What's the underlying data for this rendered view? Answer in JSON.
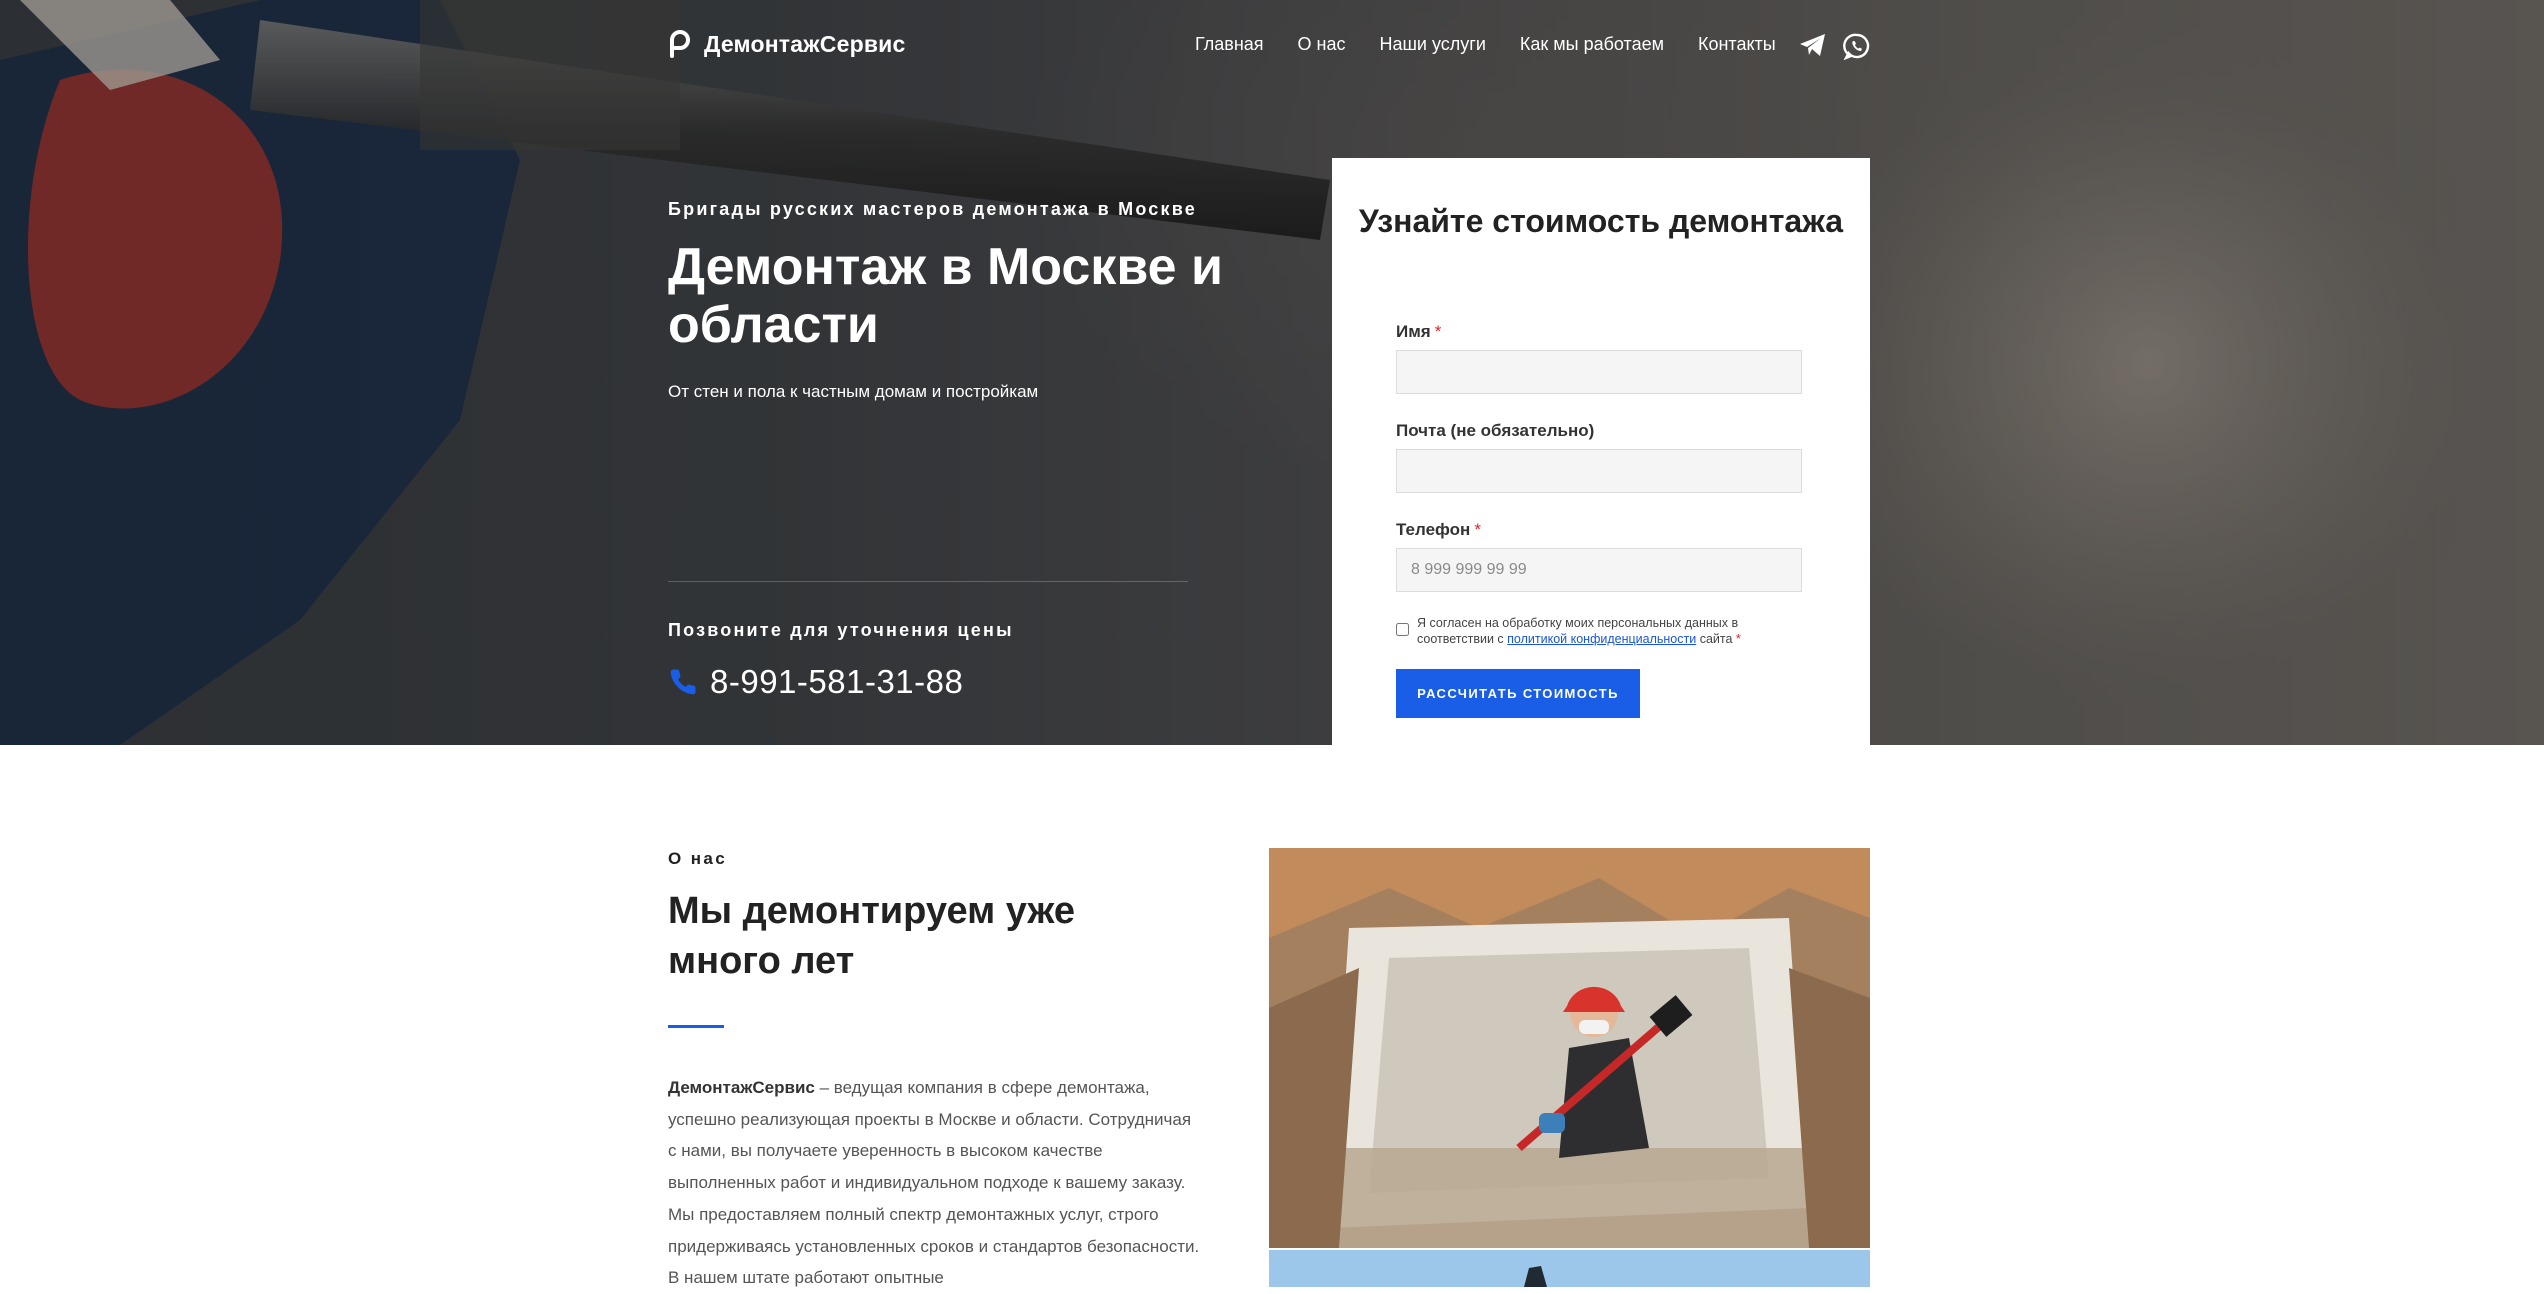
{
  "header": {
    "brand": "ДемонтажСервис",
    "nav": [
      {
        "label": "Главная"
      },
      {
        "label": "О нас"
      },
      {
        "label": "Наши услуги"
      },
      {
        "label": "Как мы работаем"
      },
      {
        "label": "Контакты"
      }
    ],
    "social_icons": [
      "telegram-icon",
      "whatsapp-icon"
    ]
  },
  "hero": {
    "eyebrow": "Бригады русских мастеров демонтажа в Москве",
    "title": "Демонтаж в Москве и области",
    "subtitle": "От стен и пола к частным домам и постройкам",
    "call_label": "Позвоните для уточнения цены",
    "phone": "8-991-581-31-88"
  },
  "form": {
    "title": "Узнайте стоимость демонтажа",
    "name_label": "Имя",
    "email_label": "Почта (не обязательно)",
    "phone_label": "Телефон",
    "required_mark": "*",
    "name_value": "",
    "email_value": "",
    "phone_placeholder": "8 999 999 99 99",
    "consent_prefix": "Я согласен на обработку моих персональных данных в соответствии с",
    "consent_link": "политикой конфиденциальности",
    "consent_suffix": "сайта",
    "submit_label": "РАССЧИТАТЬ СТОИМОСТЬ"
  },
  "about": {
    "eyebrow": "О нас",
    "title": "Мы демонтируем уже много лет",
    "brand_bold": "ДемонтажСервис",
    "text": " – ведущая компания в сфере демонтажа, успешно реализующая проекты в Москве и области. Сотрудничая с нами, вы получаете уверенность в высоком качестве выполненных работ и индивидуальном подходе к вашему заказу. Мы предоставляем полный спектр демонтажных услуг, строго придерживаясь установленных сроков и стандартов безопасности. В нашем штате работают опытные"
  },
  "colors": {
    "accent": "#1a5de6",
    "required": "#e02424",
    "text_dark": "#222222",
    "text_body": "#555555"
  }
}
